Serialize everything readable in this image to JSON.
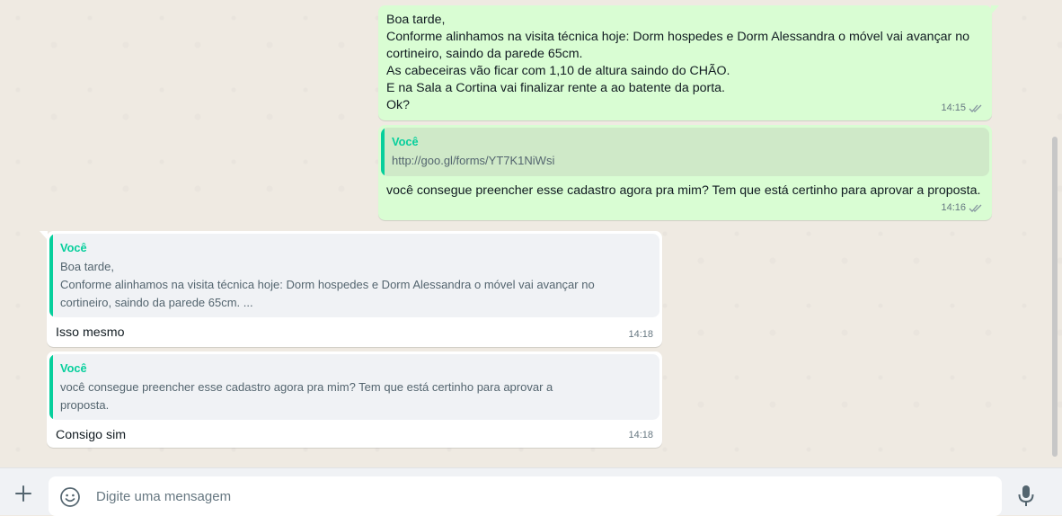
{
  "messages": {
    "m1": {
      "direction": "outgoing",
      "text": "Boa tarde,\nConforme alinhamos na visita técnica hoje: Dorm hospedes e Dorm Alessandra o móvel vai avançar no cortineiro, saindo da parede 65cm.\nAs cabeceiras vão ficar com 1,10 de altura saindo do CHÃO.\nE na Sala a Cortina vai finalizar rente a ao batente da porta.\nOk?",
      "time": "14:15"
    },
    "m2": {
      "direction": "outgoing",
      "quote_author": "Você",
      "quote_text": "http://goo.gl/forms/YT7K1NiWsi",
      "text": "você consegue preencher esse cadastro agora pra mim? Tem que está certinho para aprovar a proposta.",
      "time": "14:16"
    },
    "m3": {
      "direction": "incoming",
      "quote_author": "Você",
      "quote_text": "Boa tarde,\nConforme alinhamos na visita técnica hoje: Dorm hospedes e Dorm Alessandra o móvel vai avançar no cortineiro, saindo da parede 65cm. ...",
      "text": "Isso mesmo",
      "time": "14:18"
    },
    "m4": {
      "direction": "incoming",
      "quote_author": "Você",
      "quote_text": "você consegue preencher esse cadastro agora pra mim? Tem que está certinho para aprovar a proposta.",
      "text": "Consigo sim",
      "time": "14:18"
    }
  },
  "composer": {
    "placeholder": "Digite uma mensagem",
    "attach_icon": "plus-icon",
    "emoji_icon": "emoji-icon",
    "mic_icon": "microphone-icon"
  },
  "colors": {
    "outgoing_bubble": "#d9fdd3",
    "incoming_bubble": "#ffffff",
    "quote_accent": "#06cf9c",
    "read_ticks": "#667781",
    "chat_background": "#efeae2"
  }
}
